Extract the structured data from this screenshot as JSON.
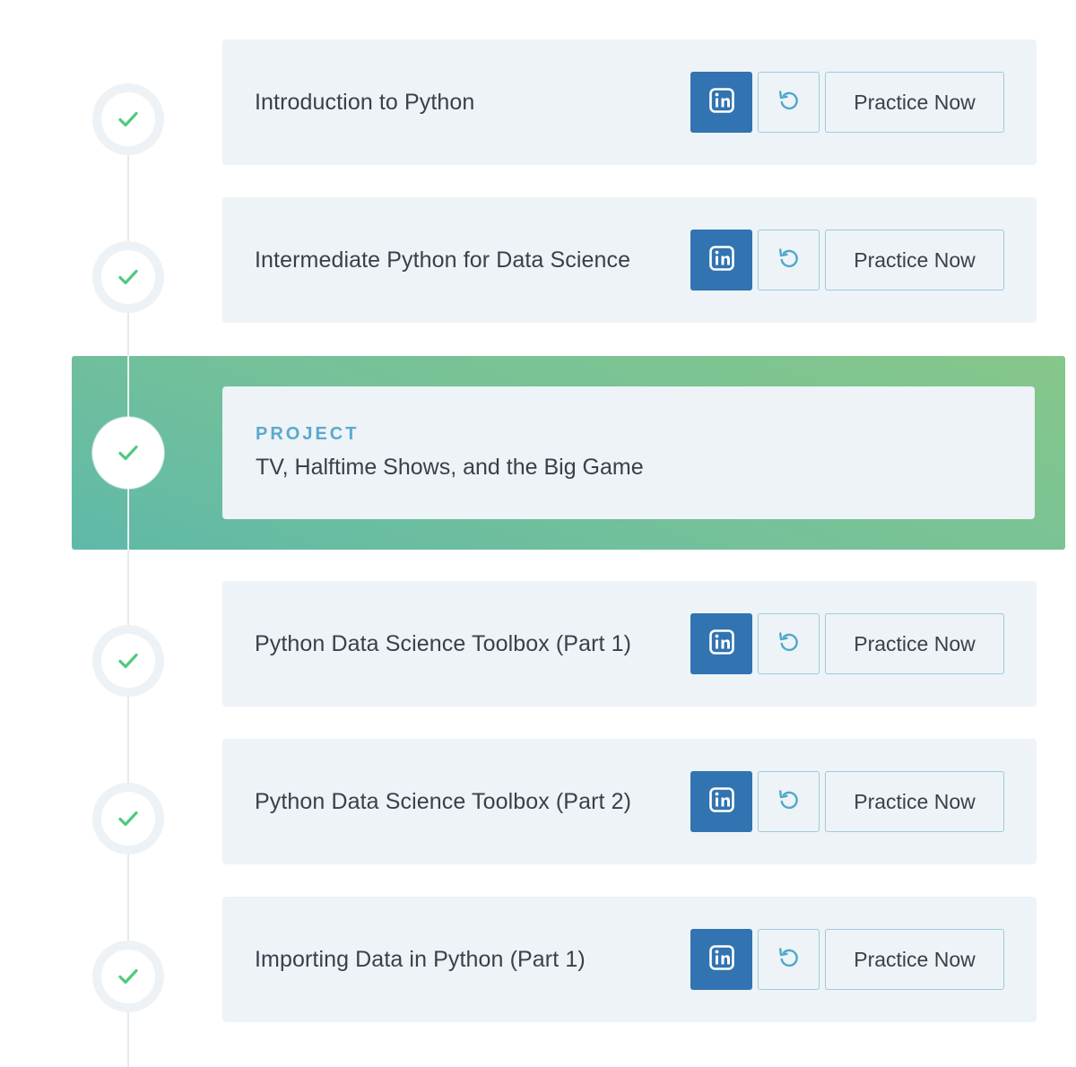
{
  "accent_colors": {
    "check": "#4fca7a",
    "linkedin_button": "#3174b1",
    "project_label": "#5aa9cc",
    "project_band_start": "#5fb9a8",
    "project_band_end": "#86c78a"
  },
  "courses": [
    {
      "title": "Introduction to Python",
      "status_icon": "check-icon",
      "linkedin_icon": "linkedin-icon",
      "reset_icon": "restart-icon",
      "practice_label": "Practice Now"
    },
    {
      "title": "Intermediate Python for Data Science",
      "status_icon": "check-icon",
      "linkedin_icon": "linkedin-icon",
      "reset_icon": "restart-icon",
      "practice_label": "Practice Now"
    }
  ],
  "project": {
    "label": "PROJECT",
    "title": "TV, Halftime Shows, and the Big Game",
    "status_icon": "check-icon"
  },
  "courses_after": [
    {
      "title": "Python Data Science Toolbox (Part 1)",
      "status_icon": "check-icon",
      "linkedin_icon": "linkedin-icon",
      "reset_icon": "restart-icon",
      "practice_label": "Practice Now"
    },
    {
      "title": "Python Data Science Toolbox (Part 2)",
      "status_icon": "check-icon",
      "linkedin_icon": "linkedin-icon",
      "reset_icon": "restart-icon",
      "practice_label": "Practice Now"
    },
    {
      "title": "Importing Data in Python (Part 1)",
      "status_icon": "check-icon",
      "linkedin_icon": "linkedin-icon",
      "reset_icon": "restart-icon",
      "practice_label": "Practice Now"
    }
  ]
}
